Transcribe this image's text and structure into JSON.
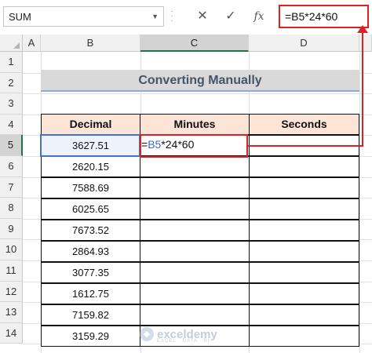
{
  "formula_bar": {
    "name_box": "SUM",
    "cancel_glyph": "✕",
    "enter_glyph": "✓",
    "fx_glyph": "fx",
    "formula": "=B5*24*60"
  },
  "columns": [
    "A",
    "B",
    "C",
    "D"
  ],
  "rows": [
    "1",
    "2",
    "3",
    "4",
    "5",
    "6",
    "7",
    "8",
    "9",
    "10",
    "11",
    "12",
    "13",
    "14"
  ],
  "sheet": {
    "title": "Converting Manually",
    "headers": {
      "decimal": "Decimal",
      "minutes": "Minutes",
      "seconds": "Seconds"
    },
    "decimals": [
      "3627.51",
      "2620.15",
      "7588.69",
      "6025.65",
      "7673.52",
      "2864.93",
      "3077.35",
      "1612.75",
      "7159.82",
      "3159.29"
    ],
    "editing_formula": {
      "eq": "=",
      "ref": "B5",
      "rest": "*24*60"
    }
  },
  "watermark": {
    "brand": "exceldemy",
    "tagline": "EXCEL · DATA · BI"
  },
  "colors": {
    "highlight": "#e02020",
    "header_fill": "#fce4d6",
    "title_fill": "#d9d9d9",
    "title_text": "#44546a",
    "excel_green": "#217346"
  }
}
